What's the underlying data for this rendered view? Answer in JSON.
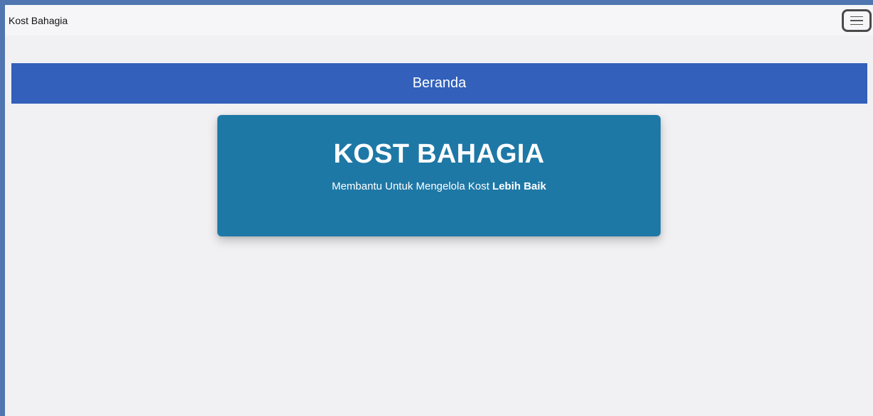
{
  "navbar": {
    "brand": "Kost Bahagia",
    "menu_icon": "hamburger-menu-icon"
  },
  "page_header": {
    "title": "Beranda"
  },
  "hero": {
    "title": "KOST BAHAGIA",
    "subtitle_prefix": "Membantu Untuk Mengelola Kost ",
    "subtitle_emphasis": "Lebih Baik"
  },
  "colors": {
    "outer_frame": "#4f76b0",
    "page_background": "#f1f1f4",
    "navbar_background": "#f6f6f9",
    "header_blue": "#3260bb",
    "hero_teal": "#1e78a6"
  }
}
